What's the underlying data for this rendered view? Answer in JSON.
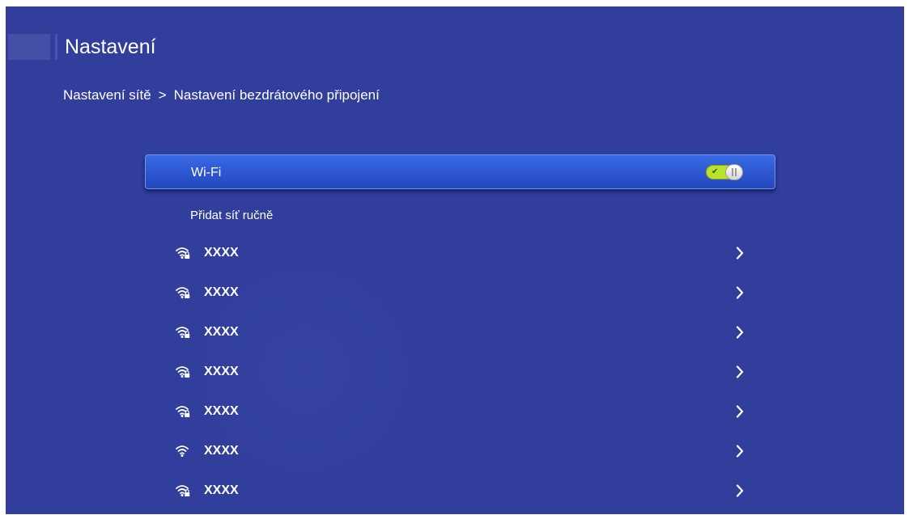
{
  "header": {
    "title": "Nastavení"
  },
  "breadcrumb": {
    "parent": "Nastavení sítě",
    "separator": ">",
    "current": "Nastavení bezdrátového připojení"
  },
  "wifi": {
    "label": "Wi-Fi",
    "enabled": true,
    "toggle_check": "✔"
  },
  "add_network": {
    "label": "Přidat síť ručně"
  },
  "networks": [
    {
      "ssid": "XXXX",
      "secured": true,
      "icon": "wifi-lock-icon"
    },
    {
      "ssid": "XXXX",
      "secured": true,
      "icon": "wifi-lock-icon"
    },
    {
      "ssid": "XXXX",
      "secured": true,
      "icon": "wifi-lock-icon"
    },
    {
      "ssid": "XXXX",
      "secured": true,
      "icon": "wifi-lock-icon"
    },
    {
      "ssid": "XXXX",
      "secured": true,
      "icon": "wifi-lock-icon"
    },
    {
      "ssid": "XXXX",
      "secured": false,
      "icon": "wifi-icon"
    },
    {
      "ssid": "XXXX",
      "secured": true,
      "icon": "wifi-lock-icon"
    }
  ],
  "colors": {
    "background": "#313e9c",
    "selection": "#2c55cf",
    "toggle_on": "#b9e22d",
    "text": "#ffffff"
  }
}
